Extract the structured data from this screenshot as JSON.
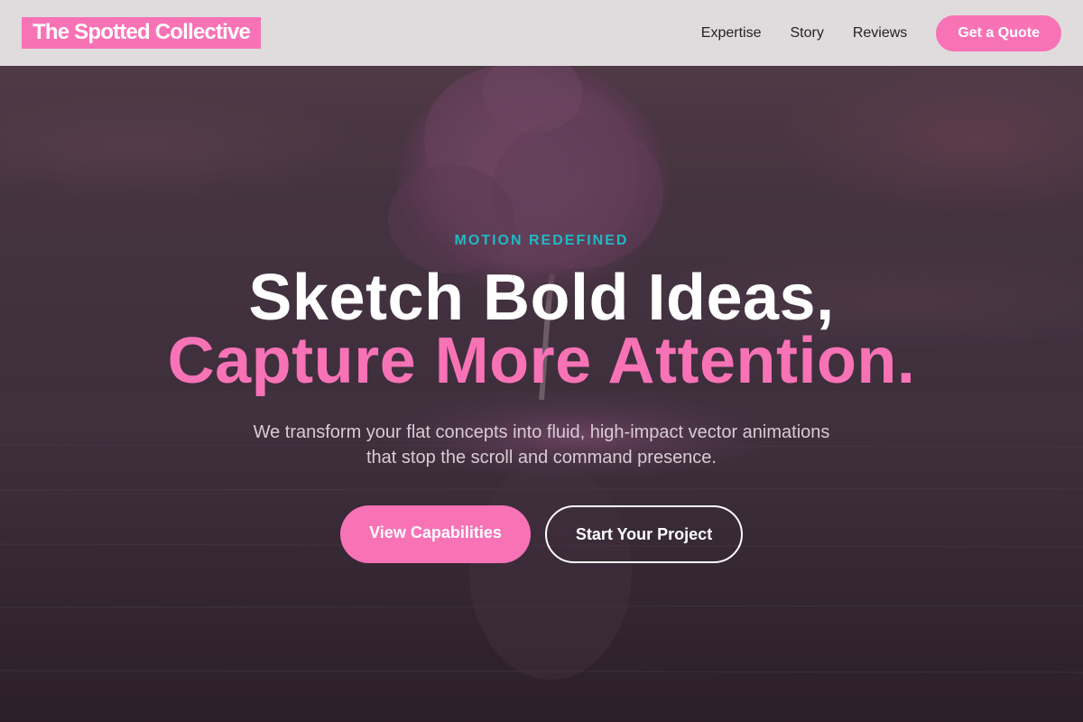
{
  "header": {
    "logo": "The Spotted Collective",
    "nav": [
      "Expertise",
      "Story",
      "Reviews"
    ],
    "cta_label": "Get a Quote"
  },
  "hero": {
    "eyebrow": "MOTION REDEFINED",
    "headline_line1": "Sketch Bold Ideas,",
    "headline_line2": "Capture More Attention.",
    "subtext": "We transform your flat concepts into fluid, high-impact vector animations that stop the scroll and command presence.",
    "primary_cta": "View Capabilities",
    "secondary_cta": "Start Your Project"
  },
  "colors": {
    "accent_pink": "#f872b6",
    "eyebrow_teal": "#1fb9c4",
    "header_bg": "#e0dcdd"
  }
}
